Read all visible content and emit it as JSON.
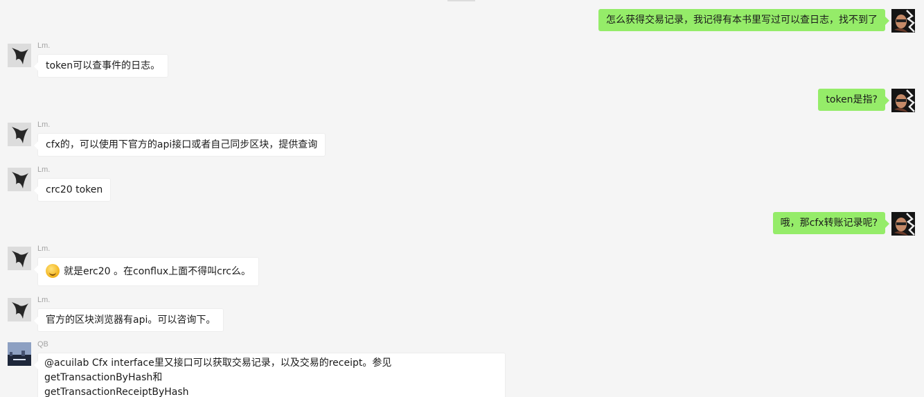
{
  "messages": [
    {
      "direction": "out",
      "sender": "",
      "text": "怎么获得交易记录，我记得有本书里写过可以查日志，找不到了"
    },
    {
      "direction": "in",
      "sender": "Lm.",
      "text": "token可以查事件的日志。"
    },
    {
      "direction": "out",
      "sender": "",
      "text": "token是指?"
    },
    {
      "direction": "in",
      "sender": "Lm.",
      "text": "cfx的，可以使用下官方的api接口或者自己同步区块，提供查询"
    },
    {
      "direction": "in",
      "sender": "Lm.",
      "text": "crc20 token"
    },
    {
      "direction": "out",
      "sender": "",
      "text": "哦，那cfx转账记录呢?"
    },
    {
      "direction": "in",
      "sender": "Lm.",
      "text": "就是erc20 。在conflux上面不得叫crc么。",
      "emoji": "grin-face-icon"
    },
    {
      "direction": "in",
      "sender": "Lm.",
      "text": "官方的区块浏览器有api。可以咨询下。"
    },
    {
      "direction": "in",
      "sender": "QB",
      "text_line1": "@acuilab Cfx interface里又接口可以获取交易记录，以及交易的receipt。参见getTransactionByHash和",
      "text_line2": "getTransactionReceiptByHash"
    }
  ],
  "colors": {
    "background": "#f5f5f5",
    "outgoing": "#95ec69",
    "incoming": "#ffffff",
    "sender_name": "#a3a3a3"
  }
}
